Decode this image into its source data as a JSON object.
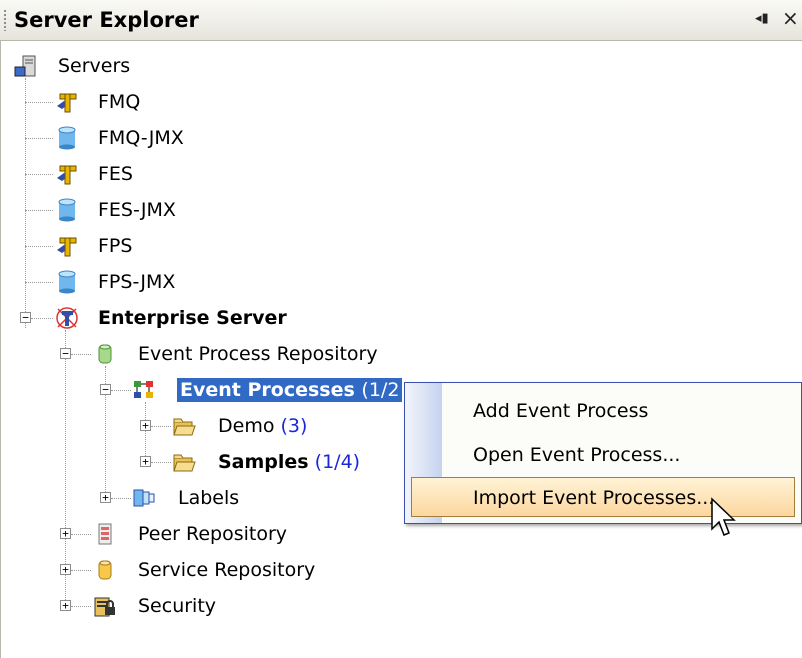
{
  "panel": {
    "title": "Server Explorer",
    "pin_glyph": "◂▮",
    "close_glyph": "×"
  },
  "tree": {
    "servers": {
      "label": "Servers",
      "children": [
        {
          "label": "FMQ",
          "icon": "server-f-icon"
        },
        {
          "label": "FMQ-JMX",
          "icon": "database-cylinder-icon"
        },
        {
          "label": "FES",
          "icon": "server-f-icon"
        },
        {
          "label": "FES-JMX",
          "icon": "database-cylinder-icon"
        },
        {
          "label": "FPS",
          "icon": "server-f-icon"
        },
        {
          "label": "FPS-JMX",
          "icon": "database-cylinder-icon"
        }
      ]
    },
    "enterprise": {
      "label": "Enterprise Server",
      "event_process_repository": "Event Process Repository",
      "event_processes": {
        "label": "Event Processes",
        "count": "(1/2"
      },
      "demo": {
        "label": "Demo",
        "count": "(3)"
      },
      "samples": {
        "label": "Samples",
        "count": "(1/4)"
      },
      "labels": "Labels",
      "peer_repository": "Peer Repository",
      "service_repository": "Service Repository",
      "security": "Security"
    }
  },
  "expander": {
    "minus": "−",
    "plus": "+"
  },
  "context_menu": {
    "items": [
      "Add Event Process",
      "Open Event Process...",
      "Import Event Processes..."
    ],
    "highlighted_index": 2
  },
  "colors": {
    "selection": "#316ac5",
    "count_text": "#1a27d8",
    "menu_highlight": "#fcd79f"
  }
}
